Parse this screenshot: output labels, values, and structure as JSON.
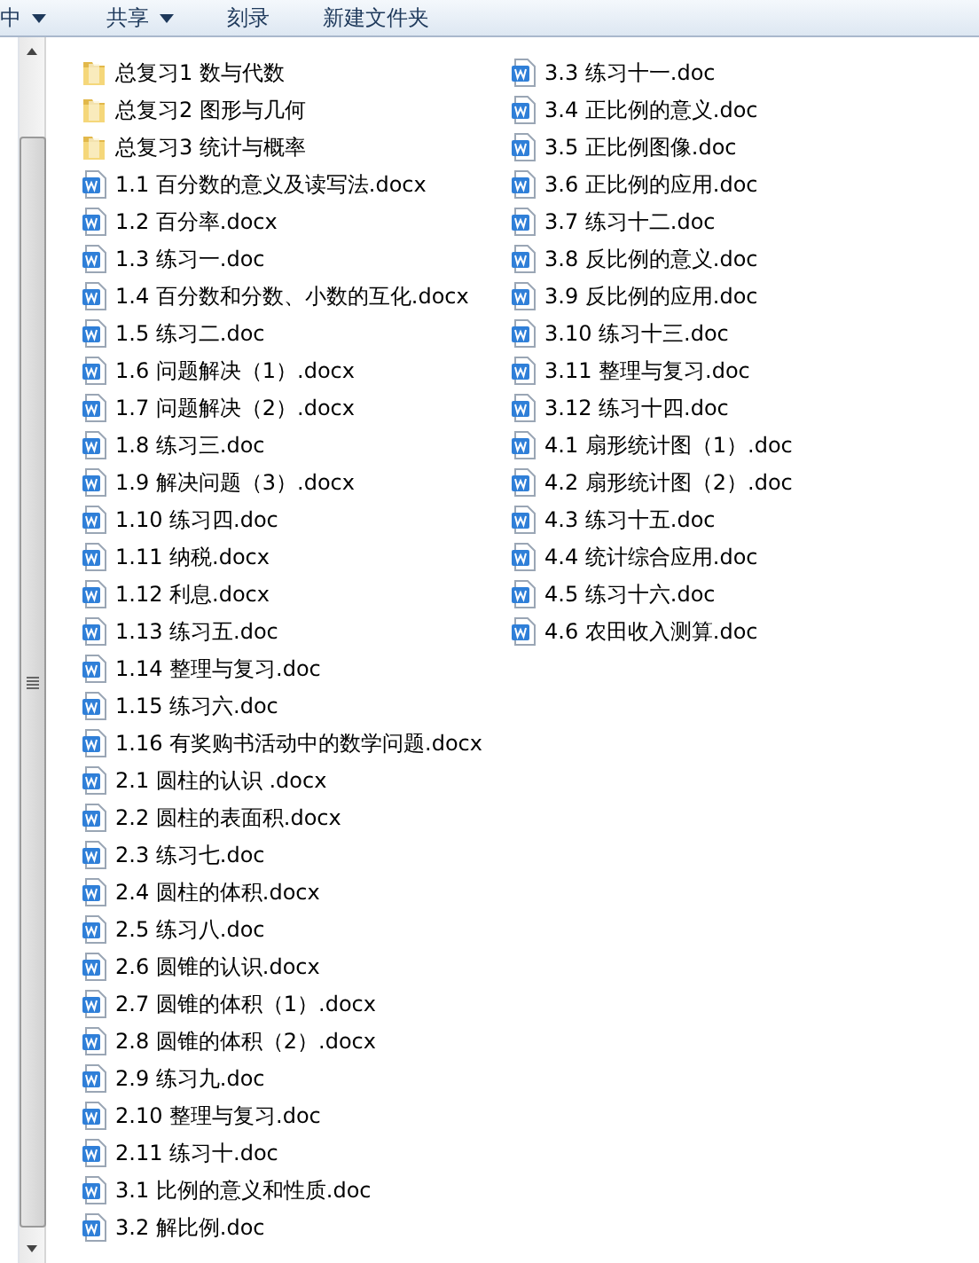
{
  "toolbar": [
    {
      "label": "中",
      "dropdown": true
    },
    {
      "label": "共享",
      "dropdown": true
    },
    {
      "label": "刻录",
      "dropdown": false
    },
    {
      "label": "新建文件夹",
      "dropdown": false
    }
  ],
  "files": [
    {
      "kind": "folder",
      "name": "总复习1 数与代数"
    },
    {
      "kind": "folder",
      "name": "总复习2 图形与几何"
    },
    {
      "kind": "folder",
      "name": "总复习3 统计与概率"
    },
    {
      "kind": "word",
      "name": "1.1 百分数的意义及读写法.docx"
    },
    {
      "kind": "word",
      "name": "1.2 百分率.docx"
    },
    {
      "kind": "word",
      "name": "1.3 练习一.doc"
    },
    {
      "kind": "word",
      "name": "1.4 百分数和分数、小数的互化.docx"
    },
    {
      "kind": "word",
      "name": "1.5 练习二.doc"
    },
    {
      "kind": "word",
      "name": "1.6 问题解决（1）.docx"
    },
    {
      "kind": "word",
      "name": "1.7 问题解决（2）.docx"
    },
    {
      "kind": "word",
      "name": "1.8 练习三.doc"
    },
    {
      "kind": "word",
      "name": "1.9 解决问题（3）.docx"
    },
    {
      "kind": "word",
      "name": "1.10 练习四.doc"
    },
    {
      "kind": "word",
      "name": "1.11 纳税.docx"
    },
    {
      "kind": "word",
      "name": "1.12 利息.docx"
    },
    {
      "kind": "word",
      "name": "1.13 练习五.doc"
    },
    {
      "kind": "word",
      "name": "1.14 整理与复习.doc"
    },
    {
      "kind": "word",
      "name": "1.15 练习六.doc"
    },
    {
      "kind": "word",
      "name": "1.16 有奖购书活动中的数学问题.docx"
    },
    {
      "kind": "word",
      "name": "2.1 圆柱的认识 .docx"
    },
    {
      "kind": "word",
      "name": "2.2 圆柱的表面积.docx"
    },
    {
      "kind": "word",
      "name": "2.3 练习七.doc"
    },
    {
      "kind": "word",
      "name": "2.4 圆柱的体积.docx"
    },
    {
      "kind": "word",
      "name": "2.5 练习八.doc"
    },
    {
      "kind": "word",
      "name": "2.6 圆锥的认识.docx"
    },
    {
      "kind": "word",
      "name": "2.7 圆锥的体积（1）.docx"
    },
    {
      "kind": "word",
      "name": "2.8 圆锥的体积（2）.docx"
    },
    {
      "kind": "word",
      "name": "2.9 练习九.doc"
    },
    {
      "kind": "word",
      "name": "2.10 整理与复习.doc"
    },
    {
      "kind": "word",
      "name": "2.11 练习十.doc"
    },
    {
      "kind": "word",
      "name": "3.1 比例的意义和性质.doc"
    },
    {
      "kind": "word",
      "name": "3.2 解比例.doc"
    },
    {
      "kind": "word",
      "name": "3.3 练习十一.doc"
    },
    {
      "kind": "word",
      "name": "3.4 正比例的意义.doc"
    },
    {
      "kind": "word",
      "name": "3.5 正比例图像.doc"
    },
    {
      "kind": "word",
      "name": "3.6 正比例的应用.doc"
    },
    {
      "kind": "word",
      "name": "3.7 练习十二.doc"
    },
    {
      "kind": "word",
      "name": "3.8 反比例的意义.doc"
    },
    {
      "kind": "word",
      "name": "3.9 反比例的应用.doc"
    },
    {
      "kind": "word",
      "name": "3.10 练习十三.doc"
    },
    {
      "kind": "word",
      "name": "3.11 整理与复习.doc"
    },
    {
      "kind": "word",
      "name": "3.12 练习十四.doc"
    },
    {
      "kind": "word",
      "name": "4.1 扇形统计图（1）.doc"
    },
    {
      "kind": "word",
      "name": "4.2 扇形统计图（2）.doc"
    },
    {
      "kind": "word",
      "name": "4.3 练习十五.doc"
    },
    {
      "kind": "word",
      "name": "4.4 统计综合应用.doc"
    },
    {
      "kind": "word",
      "name": "4.5 练习十六.doc"
    },
    {
      "kind": "word",
      "name": "4.6 农田收入测算.doc"
    }
  ]
}
